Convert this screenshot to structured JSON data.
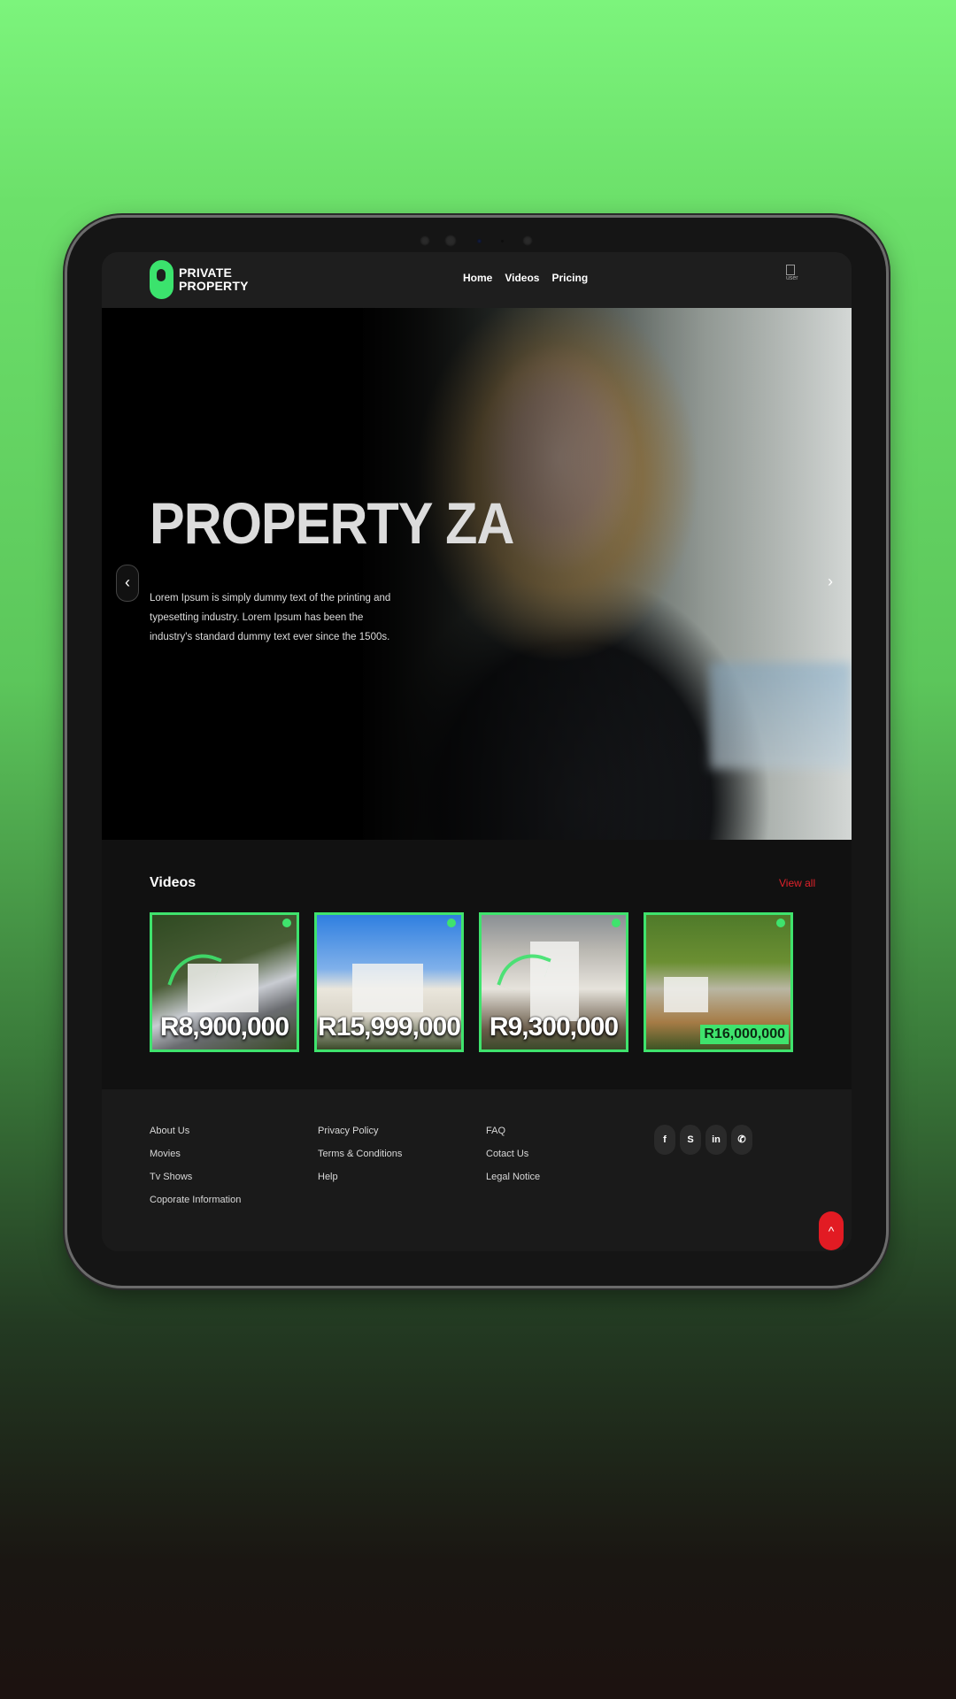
{
  "header": {
    "logo_line1": "PRIVATE",
    "logo_line2": "PROPERTY",
    "nav": [
      "Home",
      "Videos",
      "Pricing"
    ],
    "avatar_alt": "user"
  },
  "hero": {
    "title": "PROPERTY ZA",
    "description": "Lorem Ipsum is simply dummy text of the printing and typesetting industry. Lorem Ipsum has been the industry's standard dummy text ever since the 1500s.",
    "prev_icon": "‹",
    "next_icon": "›"
  },
  "videos": {
    "title": "Videos",
    "view_all": "View all",
    "cards": [
      {
        "price": "R8,900,000"
      },
      {
        "price": "R15,999,000"
      },
      {
        "price": "R9,300,000"
      },
      {
        "price": "R16,000,000"
      }
    ]
  },
  "footer": {
    "col1": [
      "About Us",
      "Movies",
      "Tv Shows",
      "Coporate Information"
    ],
    "col2": [
      "Privacy Policy",
      "Terms & Conditions",
      "Help"
    ],
    "col3": [
      "FAQ",
      "Cotact Us",
      "Legal Notice"
    ],
    "socials": [
      {
        "icon": "facebook-icon",
        "glyph": "f"
      },
      {
        "icon": "skype-icon",
        "glyph": "S"
      },
      {
        "icon": "linkedin-icon",
        "glyph": "in"
      },
      {
        "icon": "whatsapp-icon",
        "glyph": "✆"
      }
    ]
  },
  "back_to_top": "^",
  "colors": {
    "accent_green": "#3fe36d",
    "accent_red": "#e21b23"
  }
}
